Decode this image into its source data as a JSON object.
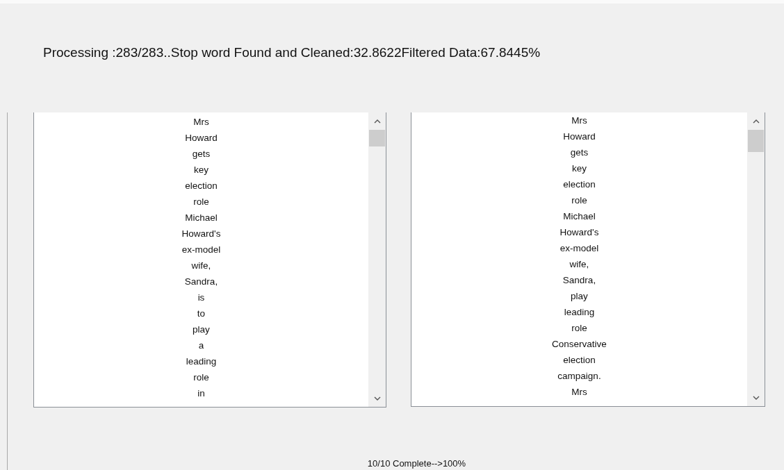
{
  "header": {
    "text": "Processing :283/283..Stop word Found and Cleaned:32.8622Filtered Data:67.8445%"
  },
  "text_areas": [
    {
      "words": [
        "Mrs",
        "Howard",
        "gets",
        "key",
        "election",
        "role",
        "Michael",
        "Howard's",
        "ex-model",
        "wife,",
        "Sandra,",
        "is",
        "to",
        "play",
        "a",
        "leading",
        "role",
        "in"
      ]
    },
    {
      "words": [
        "Mrs",
        "Howard",
        "gets",
        "key",
        "election",
        "role",
        "Michael",
        "Howard's",
        "ex-model",
        "wife,",
        "Sandra,",
        "play",
        "leading",
        "role",
        "Conservative",
        "election",
        "campaign.",
        "Mrs"
      ]
    }
  ],
  "status": {
    "text": "10/10 Complete-->100%"
  }
}
